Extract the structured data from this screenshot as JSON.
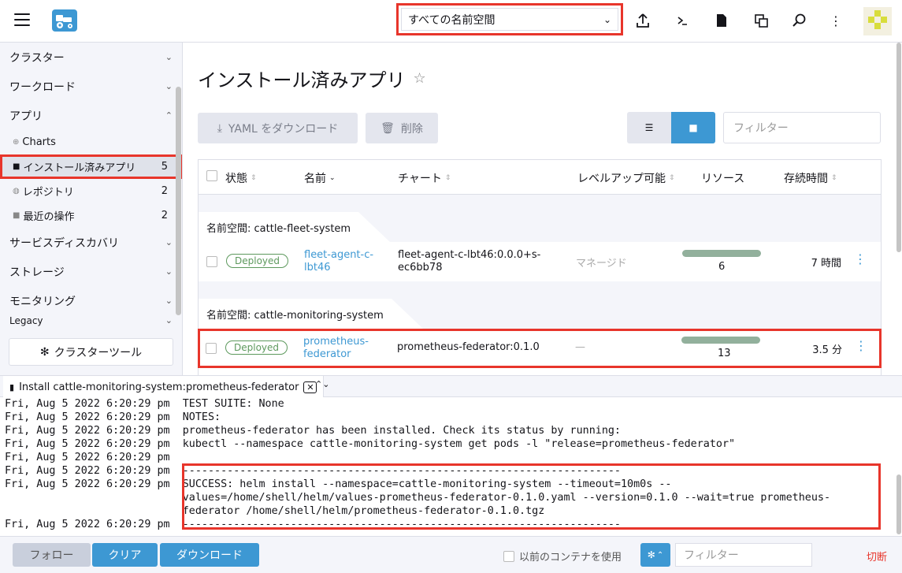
{
  "header": {
    "namespace_selected": "すべての名前空間",
    "icons": [
      "upload-icon",
      "shell-icon",
      "file-icon",
      "copy-icon",
      "search-icon",
      "more-vertical-icon"
    ]
  },
  "sidebar": {
    "groups": [
      {
        "label": "クラスター",
        "expanded": false
      },
      {
        "label": "ワークロード",
        "expanded": false
      },
      {
        "label": "アプリ",
        "expanded": true
      }
    ],
    "app_items": [
      {
        "label": "Charts",
        "count": ""
      },
      {
        "label": "インストール済みアプリ",
        "count": "5"
      },
      {
        "label": "レポジトリ",
        "count": "2"
      },
      {
        "label": "最近の操作",
        "count": "2"
      }
    ],
    "groups_after": [
      {
        "label": "サービスディスカバリ"
      },
      {
        "label": "ストレージ"
      },
      {
        "label": "モニタリング"
      },
      {
        "label": "Legacy"
      }
    ],
    "cluster_tools_label": "クラスターツール"
  },
  "main": {
    "title": "インストール済みアプリ",
    "download_yaml_label": "YAML をダウンロード",
    "delete_label": "削除",
    "filter_placeholder": "フィルター",
    "columns": {
      "state": "状態",
      "name": "名前",
      "chart": "チャート",
      "upgradeable": "レベルアップ可能",
      "resources": "リソース",
      "age": "存続時間"
    },
    "groups": [
      {
        "label": "名前空間: cattle-fleet-system",
        "row": {
          "state": "Deployed",
          "name": "fleet-agent-c-lbt46",
          "chart": "fleet-agent-c-lbt46:0.0.0+s-ec6bb78",
          "upgradeable": "マネージド",
          "resources": "6",
          "resources_healthy_fraction": 1.0,
          "age": "7 時間"
        }
      },
      {
        "label": "名前空間: cattle-monitoring-system",
        "row": {
          "state": "Deployed",
          "name": "prometheus-federator",
          "chart": "prometheus-federator:0.1.0",
          "upgradeable": "—",
          "resources": "13",
          "resources_healthy_fraction": 1.0,
          "age": "3.5 分"
        }
      }
    ]
  },
  "terminal": {
    "tab_title": "Install cattle-monitoring-system:prometheus-federator",
    "lines": [
      "Fri, Aug 5 2022 6:20:29 pm  TEST SUITE: None",
      "Fri, Aug 5 2022 6:20:29 pm  NOTES:",
      "Fri, Aug 5 2022 6:20:29 pm  prometheus-federator has been installed. Check its status by running:",
      "Fri, Aug 5 2022 6:20:29 pm  kubectl --namespace cattle-monitoring-system get pods -l \"release=prometheus-federator\"",
      "Fri, Aug 5 2022 6:20:29 pm",
      "Fri, Aug 5 2022 6:20:29 pm  ---------------------------------------------------------------------",
      "Fri, Aug 5 2022 6:20:29 pm  SUCCESS: helm install --namespace=cattle-monitoring-system --timeout=10m0s --",
      "                            values=/home/shell/helm/values-prometheus-federator-0.1.0.yaml --version=0.1.0 --wait=true prometheus-",
      "                            federator /home/shell/helm/prometheus-federator-0.1.0.tgz",
      "Fri, Aug 5 2022 6:20:29 pm  ---------------------------------------------------------------------"
    ]
  },
  "footer": {
    "follow_label": "フォロー",
    "clear_label": "クリア",
    "download_label": "ダウンロード",
    "previous_container_label": "以前のコンテナを使用",
    "filter_placeholder": "フィルター",
    "disconnect_label": "切断"
  },
  "colors": {
    "accent": "#3d98d3",
    "highlight": "#e8352b",
    "deployed": "#5d995d"
  }
}
